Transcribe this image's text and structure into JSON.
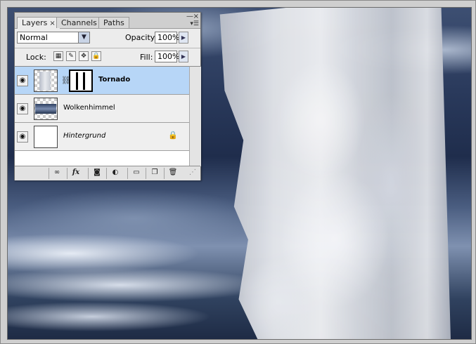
{
  "panel": {
    "tabs": [
      {
        "label": "Layers",
        "active": true,
        "close_glyph": "×"
      },
      {
        "label": "Channels",
        "active": false
      },
      {
        "label": "Paths",
        "active": false
      }
    ],
    "blend_mode": "Normal",
    "opacity_label": "Opacity:",
    "opacity_value": "100%",
    "lock_label": "Lock:",
    "fill_label": "Fill:",
    "fill_value": "100%",
    "layers": [
      {
        "name": "Tornado",
        "selected": true,
        "visible": true,
        "has_mask": true,
        "bold": true
      },
      {
        "name": "Wolkenhimmel",
        "selected": false,
        "visible": true,
        "has_mask": false
      },
      {
        "name": "Hintergrund",
        "selected": false,
        "visible": true,
        "locked": true,
        "italic": true
      }
    ]
  },
  "icons": {
    "eye": "eye-icon",
    "lock": "lock-icon",
    "link": "link-icon",
    "fx": "fx-icon",
    "mask": "add-mask-icon",
    "adjustment": "adjustment-layer-icon",
    "group": "folder-icon",
    "new_layer": "new-layer-icon",
    "delete": "trash-icon"
  },
  "colors": {
    "selected_row": "#b7d6f7",
    "panel_bg": "#ececec"
  }
}
